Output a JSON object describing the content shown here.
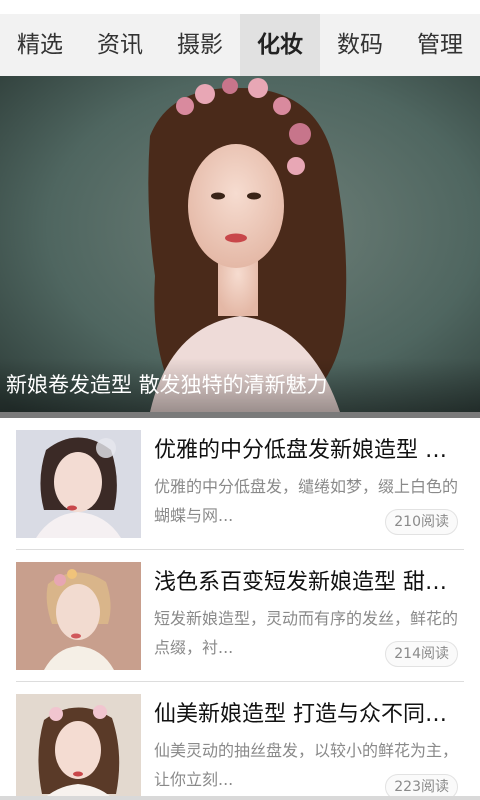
{
  "tabs": [
    {
      "label": "精选"
    },
    {
      "label": "资讯"
    },
    {
      "label": "摄影"
    },
    {
      "label": "化妆",
      "active": true
    },
    {
      "label": "数码"
    },
    {
      "label": "管理"
    }
  ],
  "hero": {
    "caption": "新娘卷发造型 散发独特的清新魅力"
  },
  "articles": [
    {
      "title": "优雅的中分低盘发新娘造型 清新迷人",
      "desc": "优雅的中分低盘发，缱绻如梦，缀上白色的蝴蝶与网...",
      "reads": "210阅读"
    },
    {
      "title": "浅色系百变短发新娘造型 甜美可人",
      "desc": "短发新娘造型，灵动而有序的发丝，鲜花的点缀，衬...",
      "reads": "214阅读"
    },
    {
      "title": "仙美新娘造型 打造与众不同的你",
      "desc": "仙美灵动的抽丝盘发，以较小的鲜花为主，让你立刻...",
      "reads": "223阅读"
    }
  ],
  "colors": {
    "tabbar_bg": "#f2f2f2",
    "tab_active_bg": "#e1e1e1",
    "desc_text": "#8a8a8a"
  }
}
